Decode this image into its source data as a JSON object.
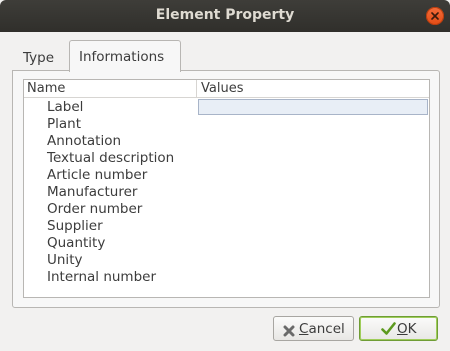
{
  "window": {
    "title": "Element Property"
  },
  "tabs": [
    {
      "label": "Type"
    },
    {
      "label": "Informations"
    }
  ],
  "table": {
    "columns": [
      "Name",
      "Values"
    ],
    "rows": [
      {
        "name": "Label",
        "value": ""
      },
      {
        "name": "Plant",
        "value": ""
      },
      {
        "name": "Annotation",
        "value": ""
      },
      {
        "name": "Textual description",
        "value": ""
      },
      {
        "name": "Article number",
        "value": ""
      },
      {
        "name": "Manufacturer",
        "value": ""
      },
      {
        "name": "Order number",
        "value": ""
      },
      {
        "name": "Supplier",
        "value": ""
      },
      {
        "name": "Quantity",
        "value": ""
      },
      {
        "name": "Unity",
        "value": ""
      },
      {
        "name": "Internal number",
        "value": ""
      }
    ]
  },
  "buttons": {
    "cancel": {
      "mnemonic": "C",
      "rest": "ancel",
      "icon": "cancel-x-icon"
    },
    "ok": {
      "mnemonic": "O",
      "rest": "K",
      "icon": "checkmark-icon"
    }
  },
  "colors": {
    "titlebar": "#3c3b37",
    "close_button": "#e95420",
    "ok_border": "#6f9d35",
    "selection": "#e8eef6"
  }
}
